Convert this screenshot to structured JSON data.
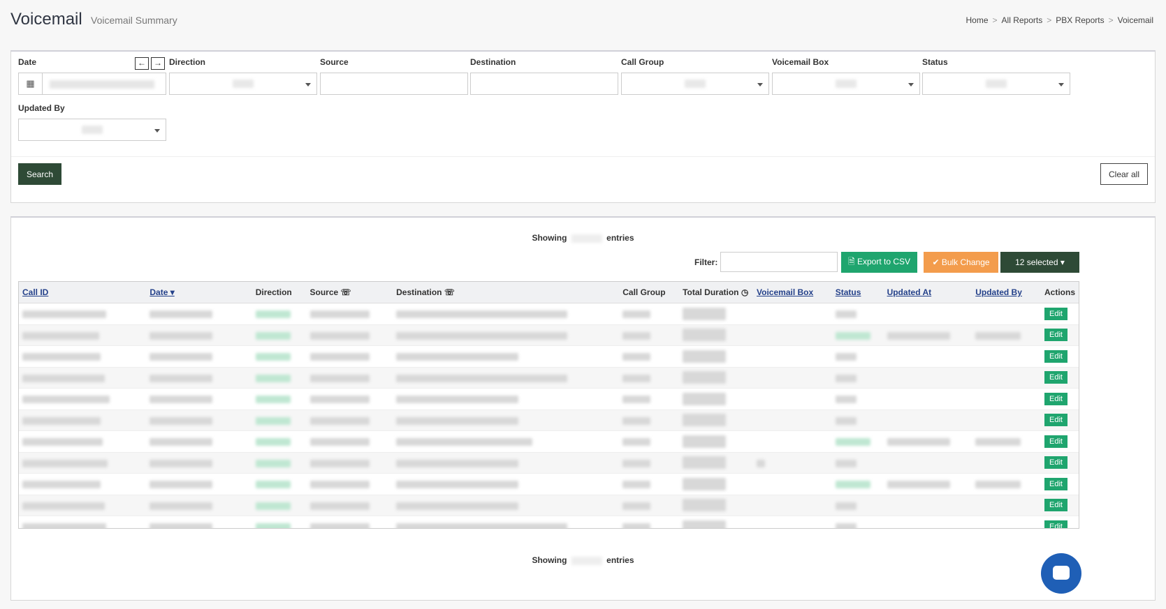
{
  "header": {
    "title": "Voicemail",
    "subtitle": "Voicemail Summary",
    "breadcrumb": [
      "Home",
      "All Reports",
      "PBX Reports",
      "Voicemail"
    ],
    "breadcrumb_separator": ">"
  },
  "filters": {
    "date_label": "Date",
    "direction_label": "Direction",
    "source_label": "Source",
    "destination_label": "Destination",
    "call_group_label": "Call Group",
    "voicemail_box_label": "Voicemail Box",
    "status_label": "Status",
    "updated_by_label": "Updated By",
    "prev_arrow": "←",
    "next_arrow": "→",
    "calendar_icon": "▦",
    "search_label": "Search",
    "clear_label": "Clear all"
  },
  "results": {
    "showing_prefix": "Showing",
    "showing_suffix": "entries",
    "filter_label": "Filter:",
    "export_label": "Export to CSV",
    "bulk_label": "Bulk Change",
    "selected_label": "12 selected",
    "columns": {
      "call_id": "Call ID",
      "date": "Date",
      "direction": "Direction",
      "source": "Source",
      "destination": "Destination",
      "call_group": "Call Group",
      "total_duration": "Total Duration",
      "voicemail_box": "Voicemail Box",
      "status": "Status",
      "updated_at": "Updated At",
      "updated_by": "Updated By",
      "actions": "Actions"
    },
    "edit_label": "Edit"
  },
  "colors": {
    "primary_dark": "#2e4a36",
    "success": "#1fa56e",
    "warning": "#f39c4c",
    "link": "#24418a"
  }
}
